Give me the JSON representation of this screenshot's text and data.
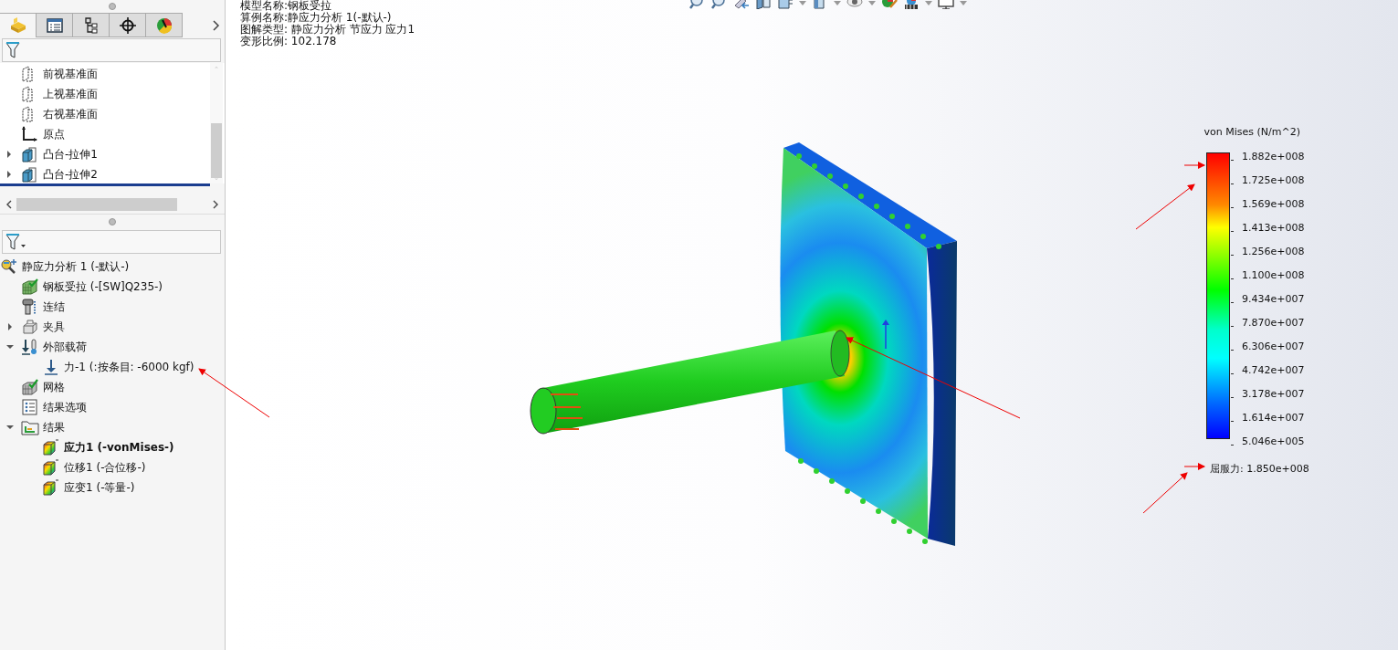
{
  "feature_tabs": [
    {
      "kind": "features",
      "selected": true
    },
    {
      "kind": "properties",
      "selected": false
    },
    {
      "kind": "config",
      "selected": false
    },
    {
      "kind": "dim",
      "selected": false
    },
    {
      "kind": "appearance",
      "selected": false
    }
  ],
  "feature_tree": [
    {
      "label": "前视基准面",
      "kind": "plane"
    },
    {
      "label": "上视基准面",
      "kind": "plane"
    },
    {
      "label": "右视基准面",
      "kind": "plane"
    },
    {
      "label": "原点",
      "kind": "origin"
    },
    {
      "label": "凸台-拉伸1",
      "kind": "extrude",
      "expanded": false
    },
    {
      "label": "凸台-拉伸2",
      "kind": "extrude",
      "expanded": false
    }
  ],
  "study_tree": [
    {
      "label": "静应力分析 1 (-默认-)",
      "kind": "study",
      "children": [
        {
          "label": "钢板受拉 (-[SW]Q235-)",
          "kind": "material"
        },
        {
          "label": "连结",
          "kind": "connection"
        },
        {
          "label": "夹具",
          "kind": "fixture",
          "expanded": false
        },
        {
          "label": "外部载荷",
          "kind": "loads",
          "expanded": true,
          "children": [
            {
              "label": "力-1 (:按条目: -6000 kgf)",
              "kind": "force"
            }
          ]
        },
        {
          "label": "网格",
          "kind": "mesh"
        },
        {
          "label": "结果选项",
          "kind": "options"
        },
        {
          "label": "结果",
          "kind": "results",
          "expanded": true,
          "children": [
            {
              "label": "应力1 (-vonMises-)",
              "kind": "plot",
              "active": true
            },
            {
              "label": "位移1 (-合位移-)",
              "kind": "plot",
              "active": false
            },
            {
              "label": "应变1 (-等量-)",
              "kind": "plot",
              "active": false
            }
          ]
        }
      ]
    }
  ],
  "plot_header": [
    "模型名称:钢板受拉",
    "算例名称:静应力分析 1(-默认-)",
    "图解类型: 静应力分析 节应力 应力1",
    "变形比例: 102.178"
  ],
  "legend": {
    "title": "von Mises (N/m^2)",
    "ticks": [
      "1.882e+008",
      "1.725e+008",
      "1.569e+008",
      "1.413e+008",
      "1.256e+008",
      "1.100e+008",
      "9.434e+007",
      "7.870e+007",
      "6.306e+007",
      "4.742e+007",
      "3.178e+007",
      "1.614e+007",
      "5.046e+005"
    ],
    "yield": "屈服力: 1.850e+008"
  }
}
